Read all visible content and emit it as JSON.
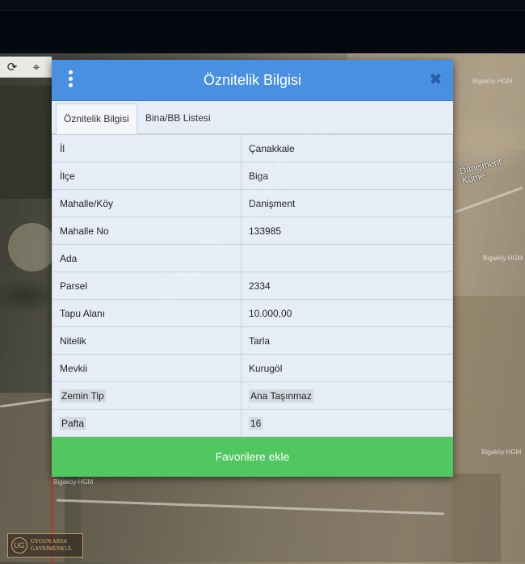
{
  "modal": {
    "title": "Öznitelik Bilgisi",
    "menu_icon": "more-vertical-icon",
    "close_icon": "close-icon",
    "close_symbol": "✖",
    "tabs": [
      {
        "label": "Öznitelik Bilgisi",
        "active": true
      },
      {
        "label": "Bina/BB Listesi",
        "active": false
      }
    ],
    "rows": [
      {
        "key": "İl",
        "value": "Çanakkale"
      },
      {
        "key": "İlçe",
        "value": "Biga"
      },
      {
        "key": "Mahalle/Köy",
        "value": "Danişment"
      },
      {
        "key": "Mahalle No",
        "value": "133985"
      },
      {
        "key": "Ada",
        "value": ""
      },
      {
        "key": "Parsel",
        "value": "2334"
      },
      {
        "key": "Tapu Alanı",
        "value": "10.000,00"
      },
      {
        "key": "Nitelik",
        "value": "Tarla"
      },
      {
        "key": "Mevkii",
        "value": "Kurugöl"
      },
      {
        "key": "Zemin Tip",
        "value": "Ana Taşınmaz"
      },
      {
        "key": "Pafta",
        "value": "16"
      }
    ],
    "favorite_button": "Favorilere ekle"
  },
  "map": {
    "tool_icons": [
      "refresh-icon",
      "locate-icon"
    ],
    "tool_symbols": [
      "⟳",
      "⌖"
    ],
    "road_label": "Danişment Küme",
    "labels": [
      "Bigaköy HGM",
      "Bigaköy HGM",
      "Bigaköy HGM",
      "Bigaköy HGM"
    ]
  },
  "watermark": "ADWEST.COM",
  "logo": {
    "mark": "UG",
    "line1": "UYGUN ARSA",
    "line2": "GAYRİMENKUL"
  },
  "colors": {
    "header": "#4a90e2",
    "favorite": "#50c760",
    "panel": "#e6edf6"
  }
}
